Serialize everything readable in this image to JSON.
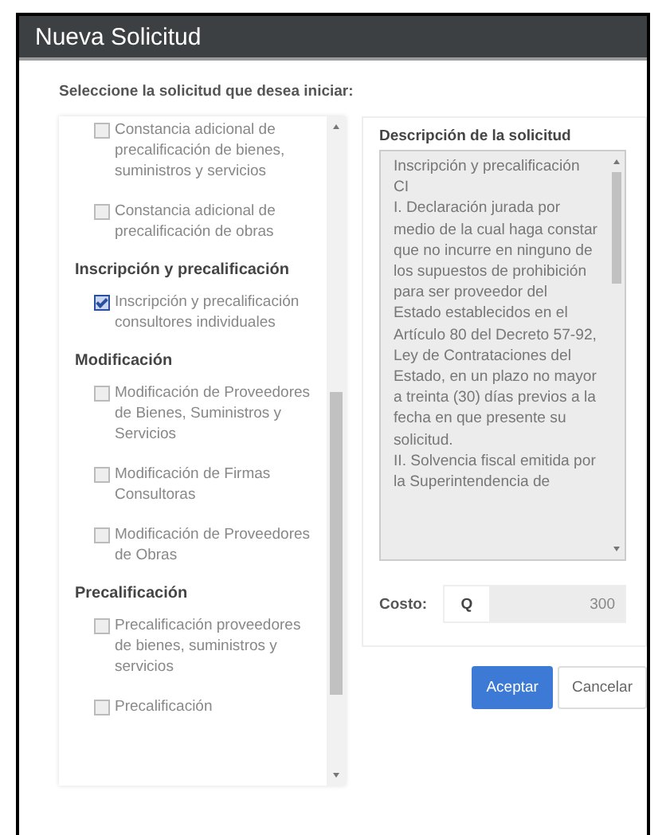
{
  "window": {
    "title": "Nueva Solicitud"
  },
  "prompt": "Seleccione la solicitud que desea iniciar:",
  "request_groups": [
    {
      "items": [
        {
          "label": "Constancia adicional de precalificación de bienes, suministros y servicios",
          "checked": false
        },
        {
          "label": "Constancia adicional de precalificación de obras",
          "checked": false
        }
      ]
    },
    {
      "heading": "Inscripción y precalificación",
      "items": [
        {
          "label": "Inscripción y precalificación consultores individuales",
          "checked": true
        }
      ]
    },
    {
      "heading": "Modificación",
      "items": [
        {
          "label": "Modificación de Proveedores de Bienes, Suministros y Servicios",
          "checked": false
        },
        {
          "label": "Modificación de Firmas Consultoras",
          "checked": false
        },
        {
          "label": "Modificación de Proveedores de Obras",
          "checked": false
        }
      ]
    },
    {
      "heading": "Precalificación",
      "items": [
        {
          "label": "Precalificación proveedores de bienes, suministros y servicios",
          "checked": false
        },
        {
          "label": "Precalificación",
          "checked": false
        }
      ]
    }
  ],
  "description": {
    "heading": "Descripción de la solicitud",
    "lines": [
      "Inscripción y precalificación CI",
      "I. Declaración jurada por medio de la cual haga constar que no incurre en ninguno de los supuestos de prohibición para ser proveedor del Estado establecidos en el Artículo 80 del Decreto 57-92, Ley de Contrataciones del Estado, en un plazo no mayor a treinta (30) días previos a la fecha en que presente su solicitud.",
      "II. Solvencia fiscal emitida por la Superintendencia de"
    ]
  },
  "cost": {
    "label": "Costo:",
    "currency": "Q",
    "value": "300"
  },
  "buttons": [
    {
      "label": "Aceptar",
      "kind": "primary"
    },
    {
      "label": "Cancelar",
      "kind": "default"
    }
  ]
}
